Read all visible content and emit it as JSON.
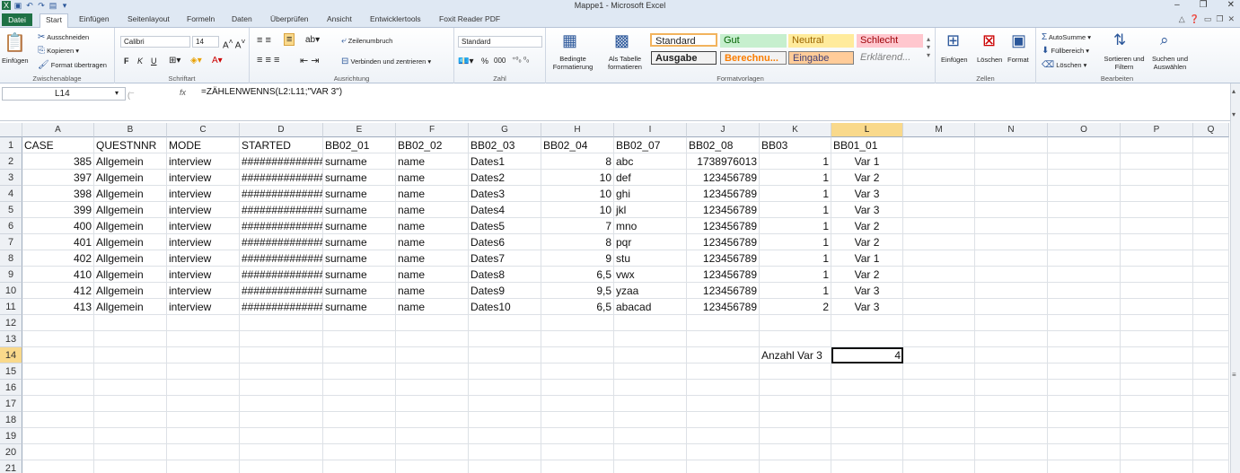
{
  "window": {
    "title": "Mappe1 - Microsoft Excel",
    "minimize": "–",
    "restore": "❐",
    "close": "✕"
  },
  "tabs": [
    "Datei",
    "Start",
    "Einfügen",
    "Seitenlayout",
    "Formeln",
    "Daten",
    "Überprüfen",
    "Ansicht",
    "Entwicklertools",
    "Foxit Reader PDF"
  ],
  "ribbon": {
    "clipboard": {
      "label": "Zwischenablage",
      "paste": "Einfügen",
      "cut": "Ausschneiden",
      "copy": "Kopieren",
      "format": "Format übertragen"
    },
    "font": {
      "label": "Schriftart",
      "name": "Calibri",
      "size": "14",
      "bold": "F",
      "italic": "K",
      "underline": "U"
    },
    "align": {
      "label": "Ausrichtung",
      "wrap": "Zeilenumbruch",
      "merge": "Verbinden und zentrieren"
    },
    "number": {
      "label": "Zahl",
      "format": "Standard",
      "percent": "%",
      "thousands": "000"
    },
    "styles": {
      "label": "Formatvorlagen",
      "cond": "Bedingte Formatierung",
      "table": "Als Tabelle formatieren",
      "items": [
        "Standard",
        "Gut",
        "Neutral",
        "Schlecht",
        "Ausgabe",
        "Berechnu...",
        "Eingabe",
        "Erklärend..."
      ]
    },
    "cells": {
      "label": "Zellen",
      "insert": "Einfügen",
      "delete": "Löschen",
      "format": "Format"
    },
    "edit": {
      "label": "Bearbeiten",
      "autosum": "AutoSumme",
      "fill": "Füllbereich",
      "clear": "Löschen",
      "sort": "Sortieren und Filtern",
      "find": "Suchen und Auswählen"
    }
  },
  "formula_bar": {
    "name_box": "L14",
    "fx": "fx",
    "formula": "=ZÄHLENWENNS(L2:L11;\"VAR 3\")"
  },
  "sheet": {
    "columns": [
      "A",
      "B",
      "C",
      "D",
      "E",
      "F",
      "G",
      "H",
      "I",
      "J",
      "K",
      "L",
      "M",
      "N",
      "O",
      "P",
      "Q"
    ],
    "rows": [
      "1",
      "2",
      "3",
      "4",
      "5",
      "6",
      "7",
      "8",
      "9",
      "10",
      "11",
      "12",
      "13",
      "14",
      "15",
      "16",
      "17",
      "18",
      "19",
      "20",
      "21"
    ],
    "header": [
      "CASE",
      "QUESTNNR",
      "MODE",
      "STARTED",
      "BB02_01",
      "BB02_02",
      "BB02_03",
      "BB02_04",
      "BB02_07",
      "BB02_08",
      "BB03",
      "BB01_01"
    ],
    "data": [
      [
        "385",
        "Allgemein",
        "interview",
        "##############",
        "surname",
        "name",
        "Dates1",
        "8",
        "abc",
        "1738976013",
        "1",
        "Var 1"
      ],
      [
        "397",
        "Allgemein",
        "interview",
        "##############",
        "surname",
        "name",
        "Dates2",
        "10",
        "def",
        "123456789",
        "1",
        "Var 2"
      ],
      [
        "398",
        "Allgemein",
        "interview",
        "##############",
        "surname",
        "name",
        "Dates3",
        "10",
        "ghi",
        "123456789",
        "1",
        "Var 3"
      ],
      [
        "399",
        "Allgemein",
        "interview",
        "##############",
        "surname",
        "name",
        "Dates4",
        "10",
        "jkl",
        "123456789",
        "1",
        "Var 3"
      ],
      [
        "400",
        "Allgemein",
        "interview",
        "##############",
        "surname",
        "name",
        "Dates5",
        "7",
        "mno",
        "123456789",
        "1",
        "Var 2"
      ],
      [
        "401",
        "Allgemein",
        "interview",
        "##############",
        "surname",
        "name",
        "Dates6",
        "8",
        "pqr",
        "123456789",
        "1",
        "Var 2"
      ],
      [
        "402",
        "Allgemein",
        "interview",
        "##############",
        "surname",
        "name",
        "Dates7",
        "9",
        "stu",
        "123456789",
        "1",
        "Var 1"
      ],
      [
        "410",
        "Allgemein",
        "interview",
        "##############",
        "surname",
        "name",
        "Dates8",
        "6,5",
        "vwx",
        "123456789",
        "1",
        "Var 2"
      ],
      [
        "412",
        "Allgemein",
        "interview",
        "##############",
        "surname",
        "name",
        "Dates9",
        "9,5",
        "yzaa",
        "123456789",
        "1",
        "Var 3"
      ],
      [
        "413",
        "Allgemein",
        "interview",
        "##############",
        "surname",
        "name",
        "Dates10",
        "6,5",
        "abacad",
        "123456789",
        "2",
        "Var 3"
      ]
    ],
    "summary_label": "Anzahl Var 3",
    "summary_value": "4"
  }
}
